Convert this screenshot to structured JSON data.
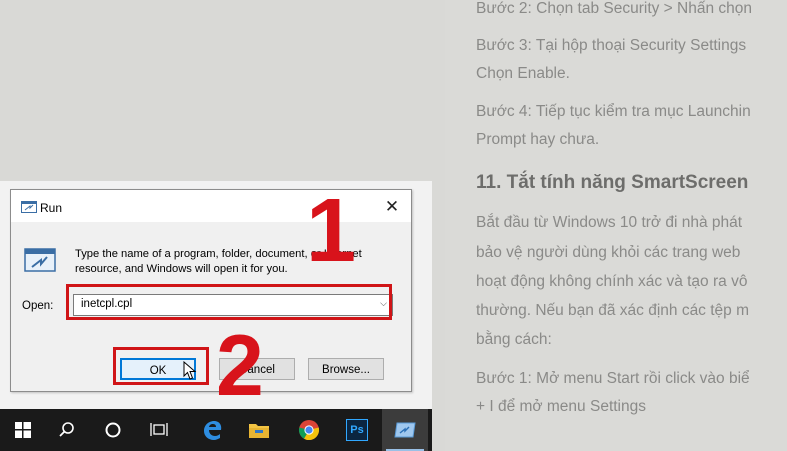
{
  "article": {
    "lines": [
      "Bước 2: Chọn tab Security > Nhấn chọn",
      "Bước 3: Tại hộp thoại Security Settings",
      "Chọn Enable.",
      "Bước 4: Tiếp tục kiểm tra mục Launchin",
      "Prompt hay chưa.",
      "Bắt đầu từ Windows 10 trở đi nhà phát",
      "bảo vệ người dùng khỏi các trang web",
      "hoạt động không chính xác và tạo ra vô",
      "thường. Nếu bạn đã xác định các tệp m",
      "bằng cách:",
      "Bước 1: Mở menu Start rồi click vào biể",
      "+ I để mở menu Settings"
    ],
    "heading": "11. Tắt tính năng SmartScreen"
  },
  "dialog": {
    "title": "Run",
    "close": "✕",
    "description": "Type the name of a program, folder, document, or Internet resource, and Windows will open it for you.",
    "open_label": "Open:",
    "open_value": "inetcpl.cpl",
    "ok_label": "OK",
    "cancel_label": "Cancel",
    "browse_label": "Browse..."
  },
  "annotations": {
    "step1": "1",
    "step2": "2",
    "highlight_color": "#d01417"
  },
  "taskbar": {
    "items": [
      "windows-start-icon",
      "search-icon",
      "cortana-icon",
      "task-view-icon",
      "edge-icon",
      "file-explorer-icon",
      "chrome-icon",
      "photoshop-icon",
      "run-app-icon"
    ],
    "photoshop_label": "Ps"
  }
}
